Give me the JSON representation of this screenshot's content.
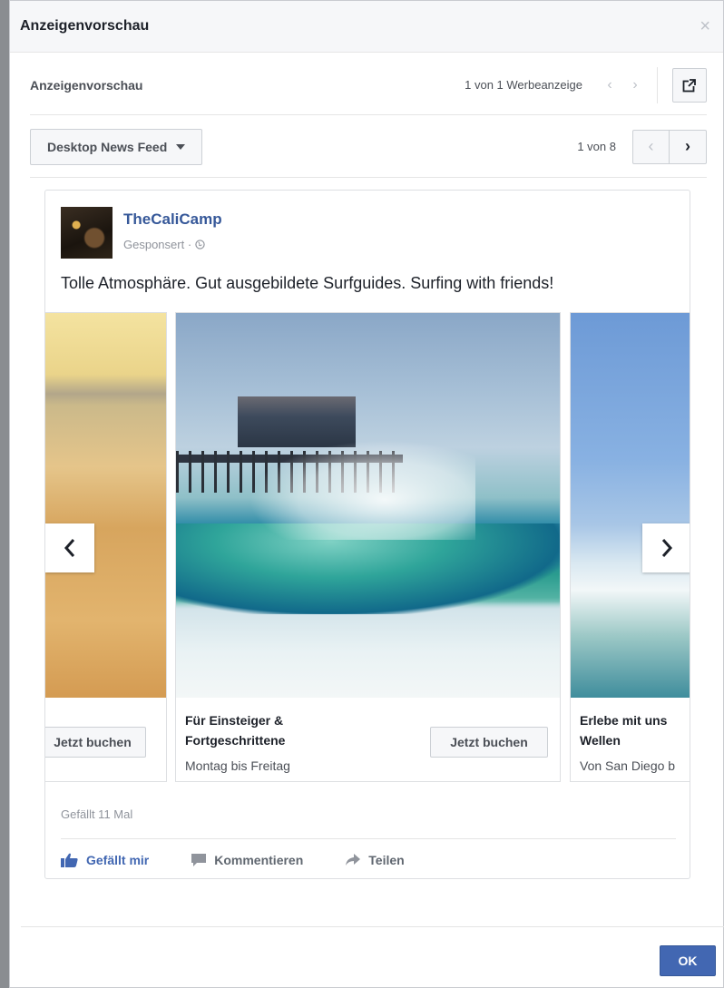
{
  "dialog": {
    "title": "Anzeigenvorschau",
    "close_icon": "close-icon"
  },
  "preview_header": {
    "title": "Anzeigenvorschau",
    "ad_counter": "1 von 1 Werbeanzeige",
    "external_icon": "open-external-icon"
  },
  "placement": {
    "selected": "Desktop News Feed",
    "page_counter": "1 von 8"
  },
  "post": {
    "page_name": "TheCaliCamp",
    "sponsored": "Gesponsert",
    "text": "Tolle Atmosphäre. Gut ausgebildete Surfguides. Surfing with friends!",
    "likes": "Gefällt 11 Mal",
    "actions": {
      "like": "Gefällt mir",
      "comment": "Kommentieren",
      "share": "Teilen"
    }
  },
  "carousel": {
    "cards": [
      {
        "headline": "",
        "description": "",
        "cta": "Jetzt buchen"
      },
      {
        "headline": "Für Einsteiger & Fortgeschrittene",
        "description": "Montag bis Freitag",
        "cta": "Jetzt buchen"
      },
      {
        "headline": "Erlebe mit uns Wellen",
        "description": "Von San Diego b",
        "cta": ""
      }
    ]
  },
  "footer": {
    "ok_label": "OK"
  },
  "colors": {
    "link_blue": "#365899",
    "like_blue": "#4267b2",
    "primary_button": "#4267b2"
  }
}
